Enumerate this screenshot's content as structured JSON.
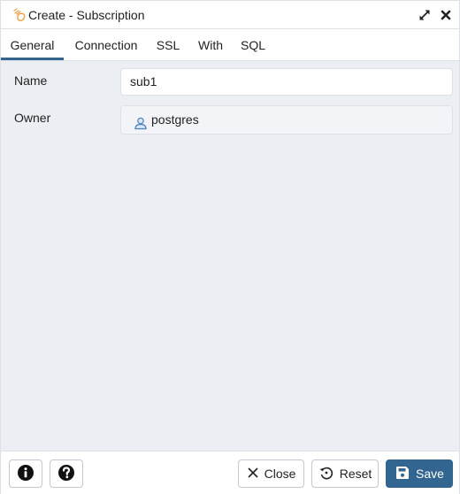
{
  "window": {
    "title": "Create - Subscription",
    "icons": {
      "title": "subscription-icon",
      "maximize": "maximize-icon",
      "close": "close-icon"
    }
  },
  "tabs": [
    {
      "label": "General",
      "active": true
    },
    {
      "label": "Connection",
      "active": false
    },
    {
      "label": "SSL",
      "active": false
    },
    {
      "label": "With",
      "active": false
    },
    {
      "label": "SQL",
      "active": false
    }
  ],
  "form": {
    "name": {
      "label": "Name",
      "value": "sub1"
    },
    "owner": {
      "label": "Owner",
      "value": "postgres",
      "icon": "user-icon"
    }
  },
  "footer": {
    "info_icon": "info-icon",
    "help_icon": "help-icon",
    "close_label": "Close",
    "reset_label": "Reset",
    "save_label": "Save"
  },
  "colors": {
    "accent": "#326690",
    "content_bg": "#ebeef3",
    "border": "#dde0e6"
  }
}
